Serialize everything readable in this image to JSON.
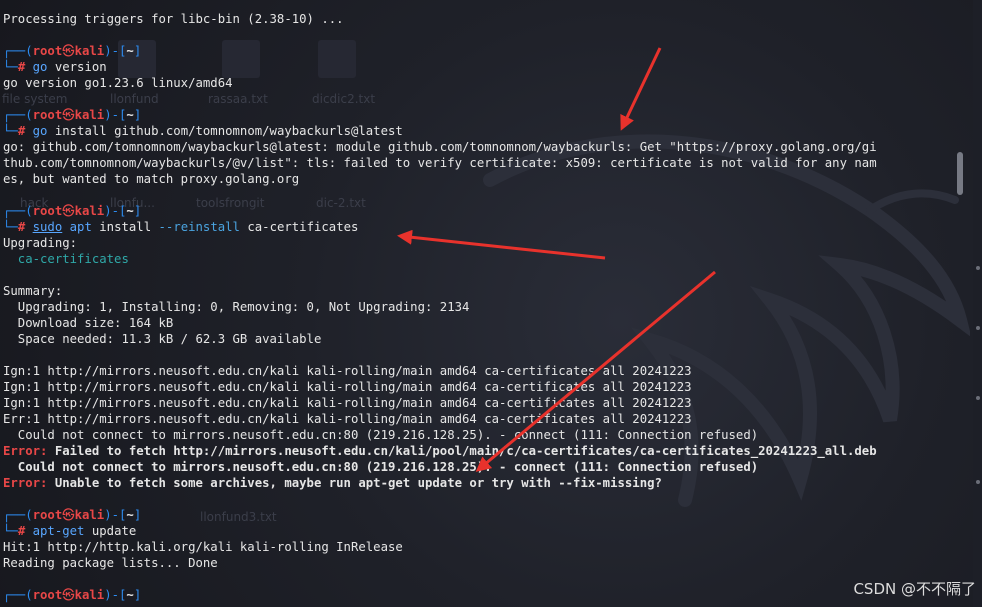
{
  "prompt": {
    "user": "root",
    "at_symbol": "㉿",
    "host": "kali",
    "dir": "~"
  },
  "lines": {
    "l1": "Processing triggers for libc-bin (2.38-10) ...",
    "c1": "go",
    "c1b": " version",
    "o1": "go version go1.23.6 linux/amd64",
    "c2": "go",
    "c2b": " install github.com/tomnomnom/waybackurls@latest",
    "o2a": "go: github.com/tomnomnom/waybackurls@latest: module github.com/tomnomnom/waybackurls: Get \"https://proxy.golang.org/gi",
    "o2b": "thub.com/tomnomnom/waybackurls/@v/list\": tls: failed to verify certificate: x509: certificate is not valid for any nam",
    "o2c": "es, but wanted to match proxy.golang.org",
    "c3_sudo": "sudo",
    "c3_apt": "apt",
    "c3_install": " install ",
    "c3_opt": "--reinstall",
    "c3_pkg": " ca-certificates",
    "up": "Upgrading:",
    "up_pkg": "  ca-certificates",
    "summary": "Summary:",
    "s1": "  Upgrading: 1, Installing: 0, Removing: 0, Not Upgrading: 2134",
    "s2": "  Download size: 164 kB",
    "s3": "  Space needed: 11.3 kB / 62.3 GB available",
    "ign1": "Ign:1 http://mirrors.neusoft.edu.cn/kali kali-rolling/main amd64 ca-certificates all 20241223",
    "ign2": "Ign:1 http://mirrors.neusoft.edu.cn/kali kali-rolling/main amd64 ca-certificates all 20241223",
    "ign3": "Ign:1 http://mirrors.neusoft.edu.cn/kali kali-rolling/main amd64 ca-certificates all 20241223",
    "err1": "Err:1 http://mirrors.neusoft.edu.cn/kali kali-rolling/main amd64 ca-certificates all 20241223",
    "cnc": "  Could not connect to mirrors.neusoft.edu.cn:80 (219.216.128.25). - connect (111: Connection refused)",
    "e1_label": "Error:",
    "e1_text": " Failed to fetch http://mirrors.neusoft.edu.cn/kali/pool/main/c/ca-certificates/ca-certificates_20241223_all.deb",
    "e1_cnc": "  Could not connect to mirrors.neusoft.edu.cn:80 (219.216.128.25). - connect (111: Connection refused)",
    "e2_label": "Error:",
    "e2_text": " Unable to fetch some archives, maybe run apt-get update or try with --fix-missing?",
    "c4": "apt-get",
    "c4b": " update",
    "hit": "Hit:1 http://http.kali.org/kali kali-rolling InRelease",
    "read": "Reading package lists... Done"
  },
  "desktop": {
    "labels": [
      "file system",
      "llonfund",
      "rassaa.txt",
      "dicdic2.txt",
      "llonfu...",
      "toolsfrongit",
      "dic-2.txt",
      "hack",
      "llonfund3.txt"
    ]
  },
  "colors": {
    "accent_red": "#e84747",
    "prompt_blue": "#2d8cf0",
    "arrow_red": "#e8322c"
  },
  "watermark": "CSDN @不不隔了"
}
